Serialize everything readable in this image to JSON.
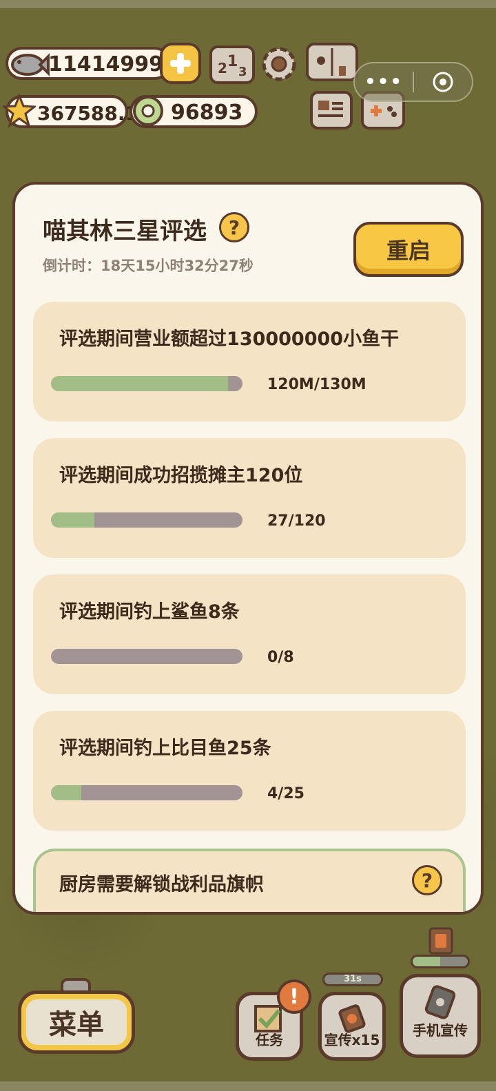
{
  "currency": {
    "fish": "114149999",
    "stars": "367588.1",
    "rings": "96893"
  },
  "modal": {
    "title": "喵其林三星评选",
    "countdown": "倒计时：18天15小时32分27秒",
    "restart_label": "重启",
    "tasks": [
      {
        "label": "评选期间营业额超过130000000小鱼干",
        "progress_text": "120M/130M",
        "progress": 0.923
      },
      {
        "label": "评选期间成功招揽摊主120位",
        "progress_text": "27/120",
        "progress": 0.225
      },
      {
        "label": "评选期间钓上鲨鱼8条",
        "progress_text": "0/8",
        "progress": 0.0
      },
      {
        "label": "评选期间钓上比目鱼25条",
        "progress_text": "4/25",
        "progress": 0.16
      }
    ],
    "locked_task": {
      "label": "厨房需要解锁战利品旗帜"
    }
  },
  "capsule": {
    "more": "•••"
  },
  "bottom_bar": {
    "menu_label": "菜单",
    "tasks_label": "任务",
    "alert_mark": "!",
    "promote_label": "宣传x15",
    "promote_timer": "31s",
    "phone_promote_label": "手机宣传",
    "phone_progress": 0.5
  },
  "colors": {
    "accent": "#f8c844",
    "progress_fill": "#a3bd86",
    "progress_track": "#a29494",
    "card_bg": "#f4e4c5",
    "modal_bg": "#fbf6ec",
    "outline": "#5a3b2b"
  },
  "icons": {
    "fish": "fish-icon",
    "plus": "plus-icon",
    "star": "star-icon",
    "ring": "ring-icon",
    "ranking": "ranking-podium-icon",
    "settings": "gear-icon",
    "book": "book-icon",
    "news": "newspaper-icon",
    "gamepad": "gamepad-icon",
    "help": "question-icon"
  }
}
